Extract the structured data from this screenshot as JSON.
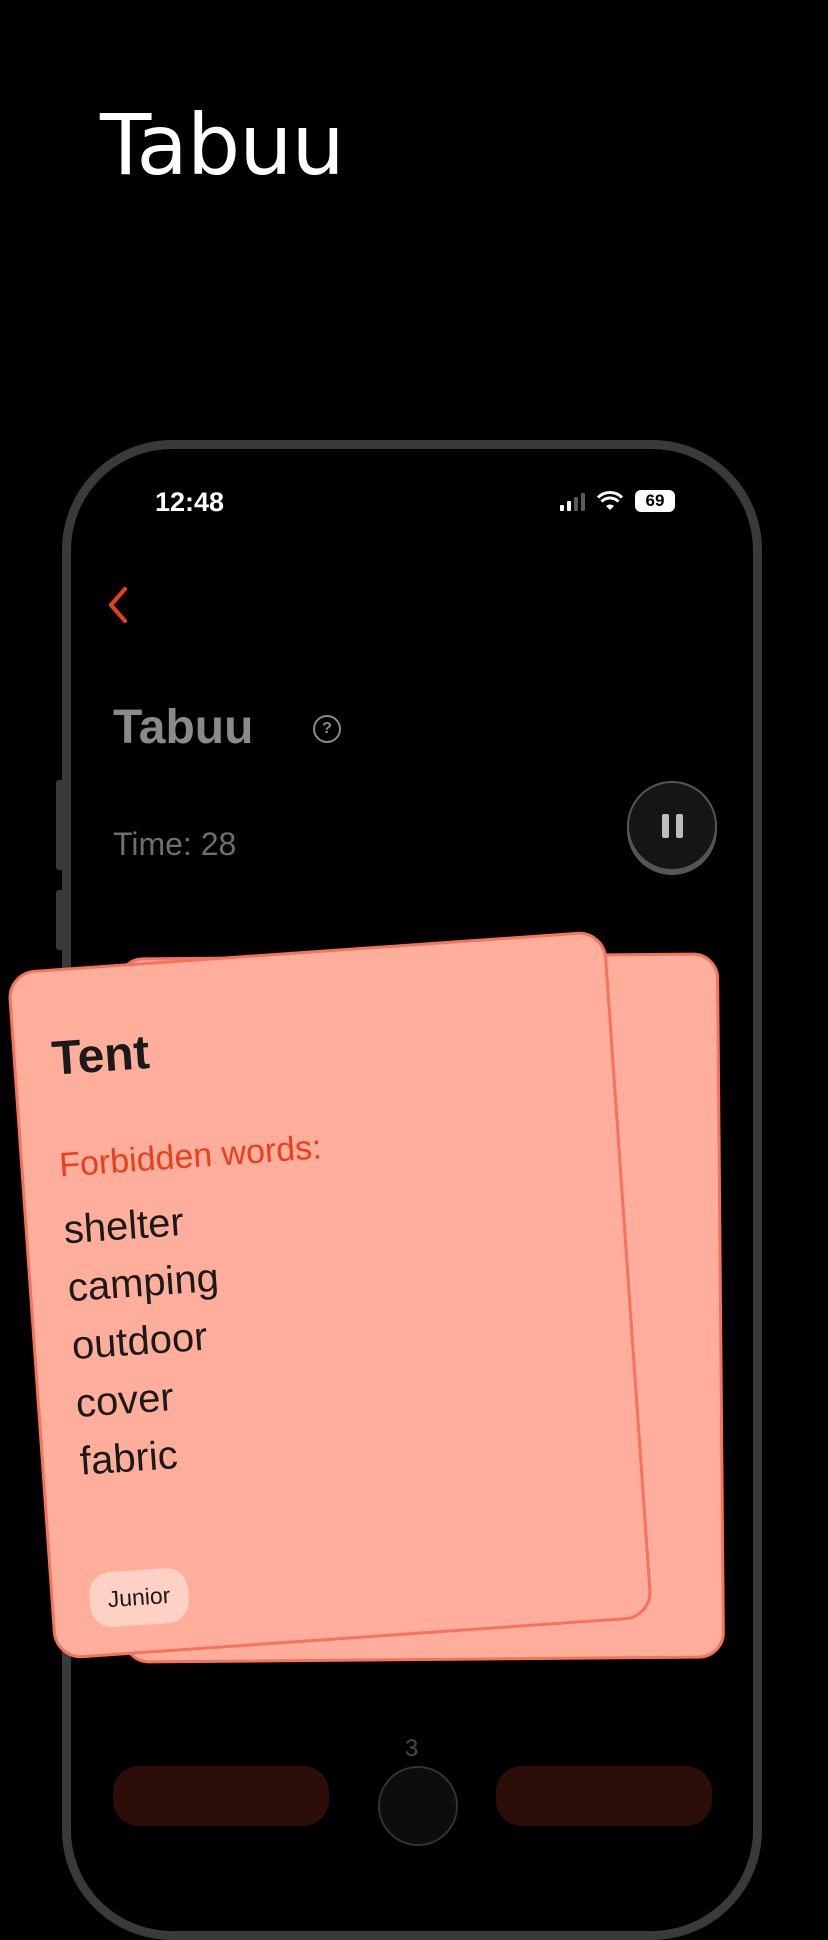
{
  "hero": {
    "title": "Tabuu"
  },
  "status_bar": {
    "time": "12:48",
    "battery": "69"
  },
  "screen": {
    "title": "Tabuu",
    "time_label": "Time: 28"
  },
  "card": {
    "word": "Tent",
    "forbidden_label": "Forbidden words:",
    "forbidden_words": [
      "shelter",
      "camping",
      "outdoor",
      "cover",
      "fabric"
    ],
    "level": "Junior"
  },
  "counter": "3",
  "icons": {
    "back": "chevron-left-icon",
    "help": "question-circle-icon",
    "pause": "pause-icon",
    "signal": "cellular-signal-icon",
    "wifi": "wifi-icon",
    "battery": "battery-icon"
  },
  "colors": {
    "background": "#000000",
    "accent": "#e8401f",
    "card": "#ffae9c",
    "card_border": "#f4735a",
    "badge": "#ffd1c5"
  }
}
